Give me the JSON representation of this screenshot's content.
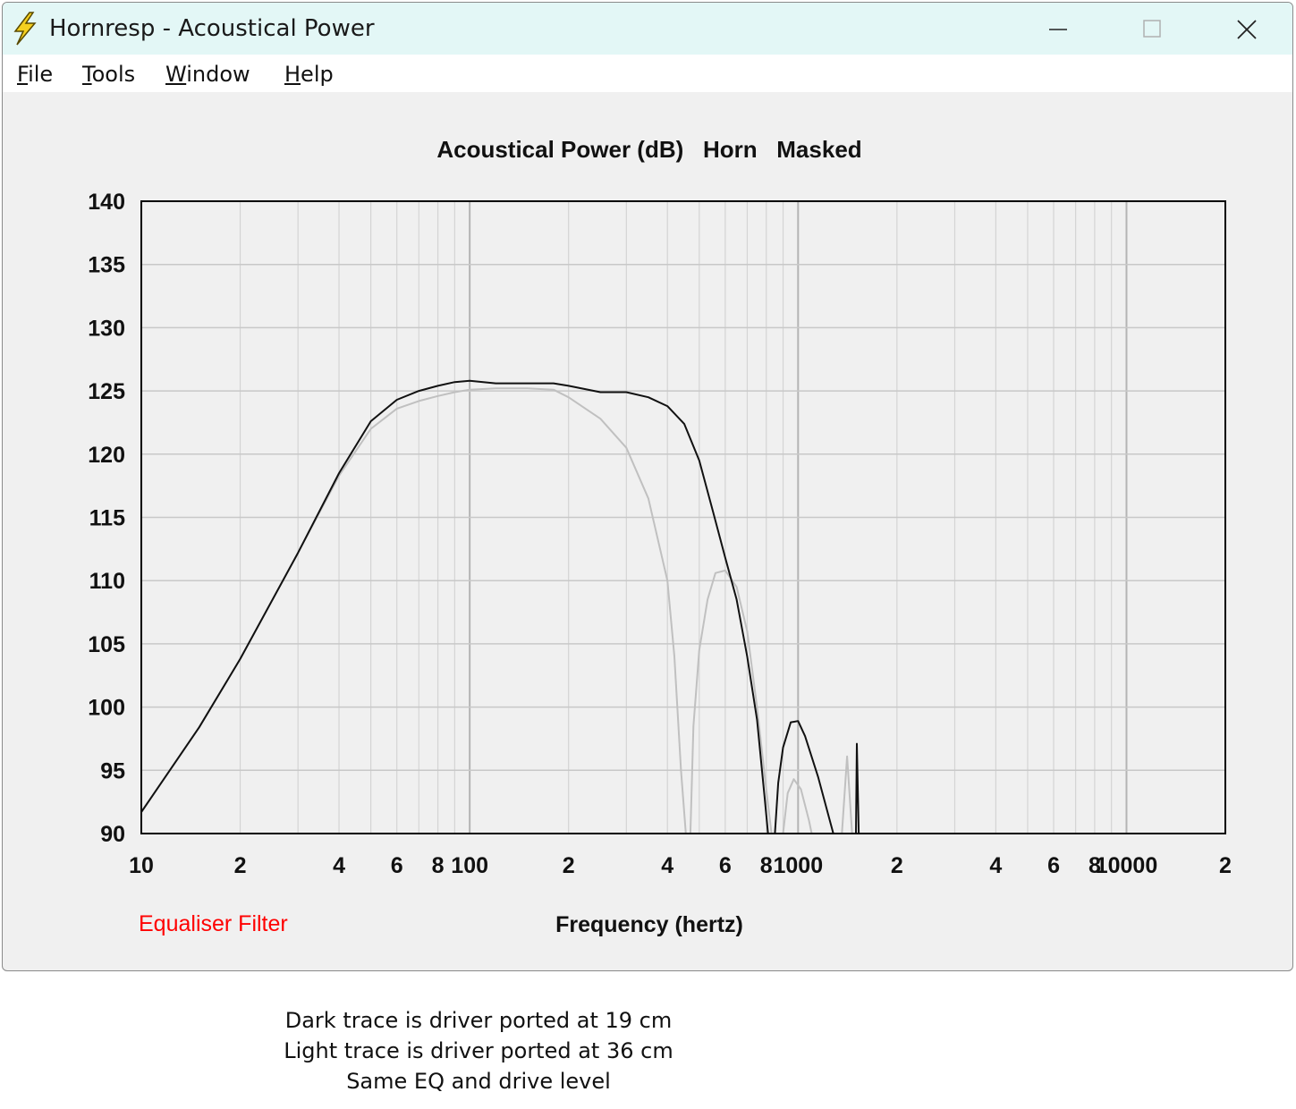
{
  "window": {
    "title": "Hornresp - Acoustical Power",
    "icon": "lightning-bolt-icon"
  },
  "menu": {
    "items": [
      {
        "label": "File",
        "accel": "F",
        "rest": "ile"
      },
      {
        "label": "Tools",
        "accel": "T",
        "rest": "ools"
      },
      {
        "label": "Window",
        "accel": "W",
        "rest": "indow"
      },
      {
        "label": "Help",
        "accel": "H",
        "rest": "elp"
      }
    ]
  },
  "status": {
    "equaliser": "Equaliser Filter",
    "equaliser_color": "#ff0000"
  },
  "chart_data": {
    "type": "line",
    "title": "Acoustical Power (dB)   Horn   Masked",
    "xlabel": "Frequency (hertz)",
    "ylabel": "",
    "xscale": "log",
    "xlim": [
      10,
      20000
    ],
    "ylim": [
      90,
      140
    ],
    "grid": true,
    "yticks": [
      140,
      135,
      130,
      125,
      120,
      115,
      110,
      105,
      100,
      95,
      90
    ],
    "xtick_labels": [
      {
        "x": 10,
        "label": "10"
      },
      {
        "x": 20,
        "label": "2"
      },
      {
        "x": 40,
        "label": "4"
      },
      {
        "x": 60,
        "label": "6"
      },
      {
        "x": 80,
        "label": "8"
      },
      {
        "x": 100,
        "label": "100"
      },
      {
        "x": 200,
        "label": "2"
      },
      {
        "x": 400,
        "label": "4"
      },
      {
        "x": 600,
        "label": "6"
      },
      {
        "x": 800,
        "label": "8"
      },
      {
        "x": 1000,
        "label": "1000"
      },
      {
        "x": 2000,
        "label": "2"
      },
      {
        "x": 4000,
        "label": "4"
      },
      {
        "x": 6000,
        "label": "6"
      },
      {
        "x": 8000,
        "label": "8"
      },
      {
        "x": 10000,
        "label": "10000"
      },
      {
        "x": 20000,
        "label": "2"
      }
    ],
    "series": [
      {
        "color": "#111111",
        "segments": [
          [
            [
              10,
              91.7
            ],
            [
              15,
              98.4
            ],
            [
              20,
              103.8
            ],
            [
              30,
              112.2
            ],
            [
              40,
              118.5
            ],
            [
              50,
              122.6
            ],
            [
              60,
              124.3
            ],
            [
              70,
              125.0
            ],
            [
              80,
              125.4
            ],
            [
              90,
              125.7
            ],
            [
              100,
              125.8
            ],
            [
              120,
              125.6
            ],
            [
              150,
              125.6
            ],
            [
              180,
              125.6
            ],
            [
              200,
              125.4
            ],
            [
              250,
              124.9
            ],
            [
              300,
              124.9
            ],
            [
              350,
              124.5
            ],
            [
              400,
              123.8
            ],
            [
              450,
              122.4
            ],
            [
              500,
              119.5
            ],
            [
              550,
              115.5
            ],
            [
              600,
              111.8
            ],
            [
              650,
              108.5
            ],
            [
              700,
              104.0
            ],
            [
              750,
              99.0
            ],
            [
              790,
              93.0
            ],
            [
              810,
              90.0
            ]
          ],
          [
            [
              850,
              90.0
            ],
            [
              870,
              94.0
            ],
            [
              900,
              96.8
            ],
            [
              950,
              98.8
            ],
            [
              1000,
              98.9
            ],
            [
              1050,
              97.7
            ],
            [
              1150,
              94.5
            ],
            [
              1250,
              91.0
            ],
            [
              1280,
              90.0
            ]
          ],
          [
            [
              1500,
              90.0
            ],
            [
              1510,
              97.1
            ],
            [
              1530,
              90.0
            ]
          ]
        ]
      },
      {
        "color": "#c0c0c0",
        "segments": [
          [
            [
              10,
              91.7
            ],
            [
              15,
              98.4
            ],
            [
              20,
              103.8
            ],
            [
              30,
              112.2
            ],
            [
              40,
              118.3
            ],
            [
              50,
              122.0
            ],
            [
              60,
              123.6
            ],
            [
              70,
              124.2
            ],
            [
              80,
              124.6
            ],
            [
              90,
              124.9
            ],
            [
              100,
              125.1
            ],
            [
              120,
              125.2
            ],
            [
              150,
              125.2
            ],
            [
              180,
              125.1
            ],
            [
              200,
              124.5
            ],
            [
              250,
              122.8
            ],
            [
              300,
              120.5
            ],
            [
              350,
              116.5
            ],
            [
              400,
              110.0
            ],
            [
              420,
              104.0
            ],
            [
              440,
              95.0
            ],
            [
              455,
              90.0
            ]
          ],
          [
            [
              470,
              90.0
            ],
            [
              480,
              98.5
            ],
            [
              500,
              104.5
            ],
            [
              530,
              108.5
            ],
            [
              560,
              110.6
            ],
            [
              600,
              110.8
            ],
            [
              650,
              109.5
            ],
            [
              700,
              106.0
            ],
            [
              750,
              100.0
            ],
            [
              800,
              93.5
            ],
            [
              830,
              90.0
            ]
          ],
          [
            [
              900,
              90.0
            ],
            [
              930,
              93.2
            ],
            [
              970,
              94.3
            ],
            [
              1020,
              93.5
            ],
            [
              1080,
              91.0
            ],
            [
              1100,
              90.0
            ]
          ],
          [
            [
              1360,
              90.0
            ],
            [
              1410,
              96.1
            ],
            [
              1460,
              90.0
            ]
          ]
        ]
      }
    ]
  },
  "caption": {
    "lines": [
      "Dark trace is driver ported at 19 cm",
      "Light trace is driver ported at 36 cm",
      "Same EQ and drive level"
    ]
  }
}
